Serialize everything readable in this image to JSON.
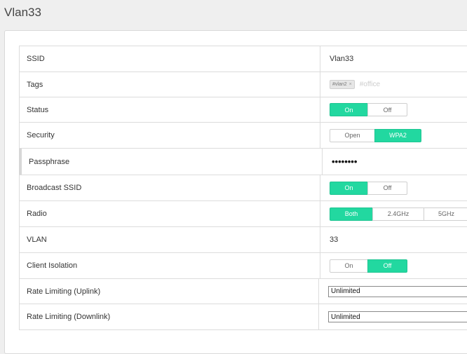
{
  "page_title": "Vlan33",
  "rows": {
    "ssid": {
      "label": "SSID",
      "value": "Vlan33"
    },
    "tags": {
      "label": "Tags",
      "tag": "#vlan2",
      "remove_glyph": "×",
      "placeholder": "#office"
    },
    "status": {
      "label": "Status",
      "on": "On",
      "off": "Off",
      "selected": "On"
    },
    "security": {
      "label": "Security",
      "open": "Open",
      "wpa2": "WPA2",
      "selected": "WPA2"
    },
    "passphrase": {
      "label": "Passphrase",
      "value": "••••••••"
    },
    "broadcast": {
      "label": "Broadcast SSID",
      "on": "On",
      "off": "Off",
      "selected": "On"
    },
    "radio": {
      "label": "Radio",
      "both": "Both",
      "g24": "2.4GHz",
      "g5": "5GHz",
      "selected": "Both"
    },
    "vlan": {
      "label": "VLAN",
      "value": "33"
    },
    "isolation": {
      "label": "Client Isolation",
      "on": "On",
      "off": "Off",
      "selected": "Off"
    },
    "rate_up": {
      "label": "Rate Limiting (Uplink)",
      "value": "Unlimited"
    },
    "rate_down": {
      "label": "Rate Limiting (Downlink)",
      "value": "Unlimited"
    }
  },
  "colors": {
    "accent": "#22d8a0",
    "background": "#efefef"
  }
}
